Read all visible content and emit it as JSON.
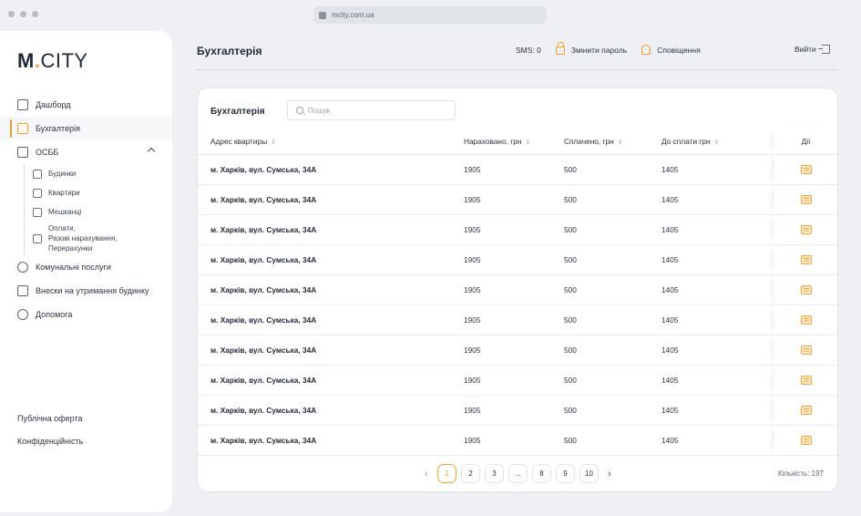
{
  "browser": {
    "url": "mcity.com.ua"
  },
  "logo": {
    "m": "M",
    "dot": ".",
    "city": "CITY"
  },
  "sidebar": {
    "items": [
      {
        "label": "Дашборд",
        "icon": "dashboard-icon"
      },
      {
        "label": "Бухгалтерія",
        "icon": "calculator-icon",
        "active": true
      },
      {
        "label": "ОСББ",
        "icon": "osbb-icon",
        "expanded": true
      }
    ],
    "sub_items": [
      {
        "label": "Будинки",
        "icon": "house-icon"
      },
      {
        "label": "Квартири",
        "icon": "key-icon"
      },
      {
        "label": "Мешканці",
        "icon": "people-icon"
      },
      {
        "label_lines": [
          "Оплати,",
          "Разові нарахування,",
          "Перерахунки"
        ],
        "icon": "wallet-icon"
      }
    ],
    "bottom_items": [
      {
        "label": "Комунальні послуги",
        "icon": "wrench-icon"
      },
      {
        "label": "Внески на утримання будинку",
        "icon": "card-icon"
      },
      {
        "label": "Допомога",
        "icon": "help-icon"
      }
    ],
    "footer": {
      "offer": "Публічна оферта",
      "privacy": "Конфіденційність"
    }
  },
  "header": {
    "title": "Бухгалтерія",
    "sms": "SMS: 0",
    "change_password": "Змінити пароль",
    "notifications": "Сповіщення",
    "logout": "Вийти"
  },
  "card": {
    "title": "Бухгалтерія",
    "search_placeholder": "Пошук"
  },
  "table": {
    "columns": [
      "Адрес квартиры",
      "Нараховано, грн",
      "Сплачено, грн",
      "До сплати грн",
      "Дії"
    ],
    "rows": [
      {
        "address": "м. Харків, вул. Сумська, 34А",
        "charged": "1905",
        "paid": "500",
        "due": "1405"
      },
      {
        "address": "м. Харків, вул. Сумська, 34А",
        "charged": "1905",
        "paid": "500",
        "due": "1405"
      },
      {
        "address": "м. Харків, вул. Сумська, 34А",
        "charged": "1905",
        "paid": "500",
        "due": "1405"
      },
      {
        "address": "м. Харків, вул. Сумська, 34А",
        "charged": "1905",
        "paid": "500",
        "due": "1405"
      },
      {
        "address": "м. Харків, вул. Сумська, 34А",
        "charged": "1905",
        "paid": "500",
        "due": "1405"
      },
      {
        "address": "м. Харків, вул. Сумська, 34А",
        "charged": "1905",
        "paid": "500",
        "due": "1405"
      },
      {
        "address": "м. Харків, вул. Сумська, 34А",
        "charged": "1905",
        "paid": "500",
        "due": "1405"
      },
      {
        "address": "м. Харків, вул. Сумська, 34А",
        "charged": "1905",
        "paid": "500",
        "due": "1405"
      },
      {
        "address": "м. Харків, вул. Сумська, 34А",
        "charged": "1905",
        "paid": "500",
        "due": "1405"
      },
      {
        "address": "м. Харків, вул. Сумська, 34А",
        "charged": "1905",
        "paid": "500",
        "due": "1405"
      }
    ]
  },
  "pagination": {
    "pages": [
      "1",
      "2",
      "3",
      "...",
      "8",
      "9",
      "10"
    ],
    "current": "1",
    "prev": "‹",
    "next": "›",
    "count": "Кількість: 197"
  },
  "colors": {
    "accent": "#f59e2e",
    "background": "#eef0f3"
  }
}
